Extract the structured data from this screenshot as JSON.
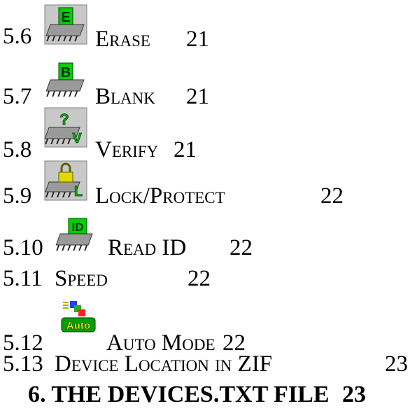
{
  "entries": [
    {
      "number": "5.6",
      "title": "Erase",
      "page": "21",
      "icon": "erase-chip-icon"
    },
    {
      "number": "5.7",
      "title": "Blank",
      "page": "21",
      "icon": "blank-chip-icon"
    },
    {
      "number": "5.8",
      "title": "Verify",
      "page": "21",
      "icon": "verify-chip-icon"
    },
    {
      "number": "5.9",
      "title": "Lock/Protect",
      "page": "22",
      "icon": "lock-chip-icon"
    },
    {
      "number": "5.10",
      "title": "Read ID",
      "page": "22",
      "icon": "read-id-chip-icon"
    },
    {
      "number": "5.11",
      "title": "Speed",
      "page": "22"
    },
    {
      "number": "5.12",
      "title": "Auto Mode",
      "page": "22",
      "icon": "auto-mode-icon"
    },
    {
      "number": "5.13",
      "title": "Device Location in ZIF",
      "page": "23"
    }
  ],
  "section": {
    "title": "6. THE DEVICES.TXT FILE",
    "page": "23"
  }
}
